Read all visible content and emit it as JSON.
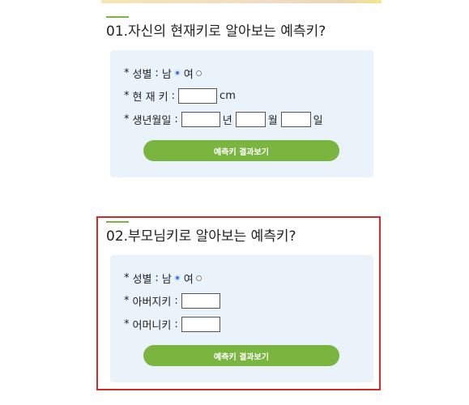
{
  "section1": {
    "title": "01.자신의 현재키로 알아보는 예측키?",
    "gender": {
      "bullet": "*",
      "label": "성별",
      "colon": ":",
      "male": "남",
      "female": "여"
    },
    "height": {
      "bullet": "*",
      "label": "현 재 키",
      "colon": ":",
      "value": "",
      "unit": "cm"
    },
    "birth": {
      "bullet": "*",
      "label": "생년월일",
      "colon": ":",
      "year_unit": "년",
      "month_unit": "월",
      "day_unit": "일",
      "year": "",
      "month": "",
      "day": ""
    },
    "button": "예측키 결과보기"
  },
  "section2": {
    "title": "02.부모님키로 알아보는 예측키?",
    "gender": {
      "bullet": "*",
      "label": "성별",
      "colon": ":",
      "male": "남",
      "female": "여"
    },
    "father": {
      "bullet": "*",
      "label": "아버지키",
      "colon": ":",
      "value": ""
    },
    "mother": {
      "bullet": "*",
      "label": "어머니키",
      "colon": ":",
      "value": ""
    },
    "button": "예측키 결과보기"
  },
  "colors": {
    "accent": "#7ab540",
    "panel": "#eaf2fa",
    "highlight": "#d42a2a",
    "radio_selected": "#3a7bd5"
  },
  "icons": {
    "radio_selected": "radio-selected-icon",
    "radio_unselected": "radio-unselected-icon"
  }
}
